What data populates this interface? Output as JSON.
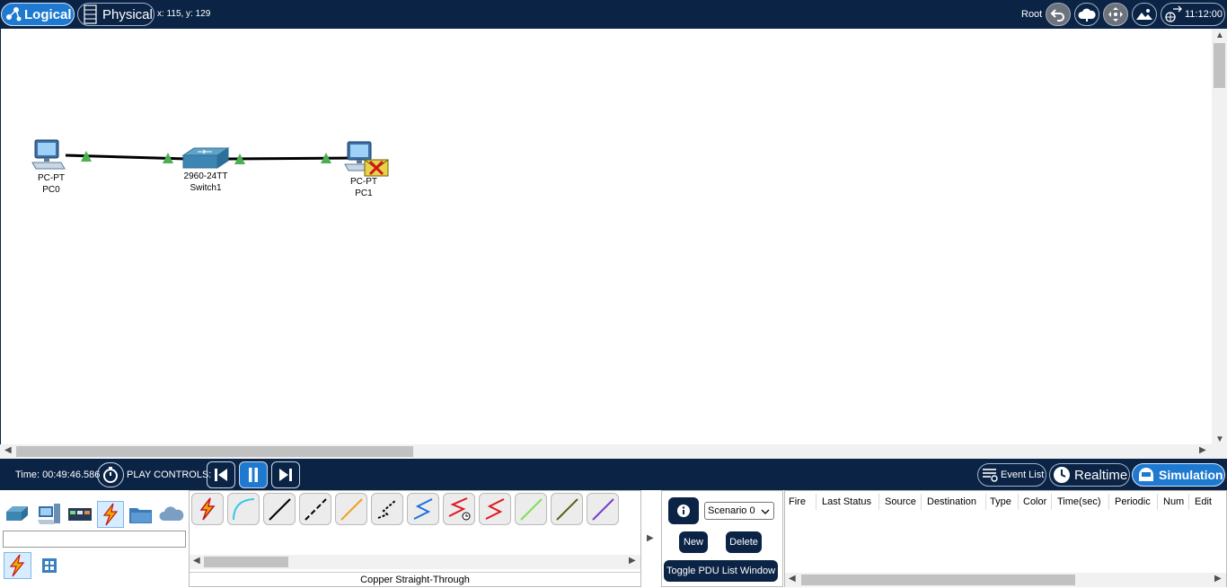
{
  "topbar": {
    "logical_label": "Logical",
    "physical_label": "Physical",
    "coords_text": "x: 115, y: 129",
    "root_label": "Root",
    "clock_text": "11:12:00"
  },
  "canvas": {
    "devices": [
      {
        "model": "PC-PT",
        "name": "PC0"
      },
      {
        "model": "2960-24TT",
        "name": "Switch1"
      },
      {
        "model": "PC-PT",
        "name": "PC1"
      }
    ]
  },
  "simbar": {
    "time_text": "Time: 00:49:46.586",
    "play_controls_label": "PLAY CONTROLS:",
    "event_list_label": "Event List",
    "realtime_label": "Realtime",
    "simulation_label": "Simulation"
  },
  "device_panel": {
    "search_value": ""
  },
  "cable_panel": {
    "selected_cable_name": "Copper Straight-Through",
    "cables": [
      "automatic-icon",
      "console-icon",
      "copper-straight-icon",
      "copper-cross-icon",
      "fiber-icon",
      "phone-icon",
      "coaxial-icon",
      "serial-dce-icon",
      "serial-dte-icon",
      "octal-icon",
      "iot-custom-icon",
      "usb-icon"
    ]
  },
  "scenario_panel": {
    "scenario_value": "Scenario 0",
    "new_label": "New",
    "delete_label": "Delete",
    "toggle_label": "Toggle PDU List Window"
  },
  "pdu_table": {
    "headers": [
      "Fire",
      "Last Status",
      "Source",
      "Destination",
      "Type",
      "Color",
      "Time(sec)",
      "Periodic",
      "Num",
      "Edit"
    ]
  },
  "colors": {
    "navy": "#0b2446",
    "accent_blue": "#1e7ad1",
    "link_up_green": "#4caf50"
  }
}
